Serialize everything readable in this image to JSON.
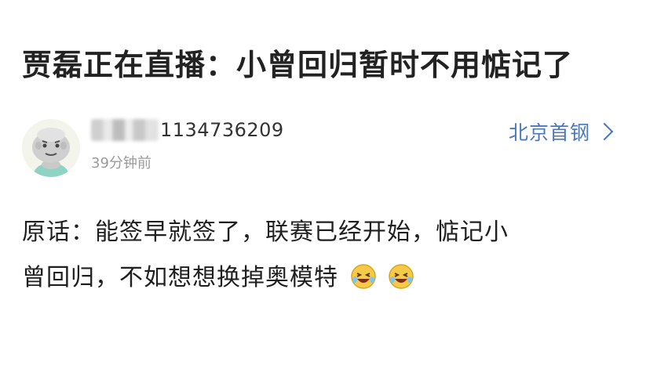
{
  "headline": "贾磊正在直播：小曾回归暂时不用惦记了",
  "post": {
    "username_visible": "1134736209",
    "time": "39分钟前",
    "team": "北京首钢",
    "comment_line1": "原话：能签早就签了，联赛已经开始，惦记小",
    "comment_line2": "曾回归，不如想想换掉奥模特"
  },
  "icons": {
    "avatar": "cartoon-avatar",
    "chevron": "chevron-right-icon",
    "emoji": "laughing-tears-emoji"
  },
  "colors": {
    "accent": "#4a78c0",
    "meta": "#9a9a9a",
    "text": "#1f1f1f"
  }
}
